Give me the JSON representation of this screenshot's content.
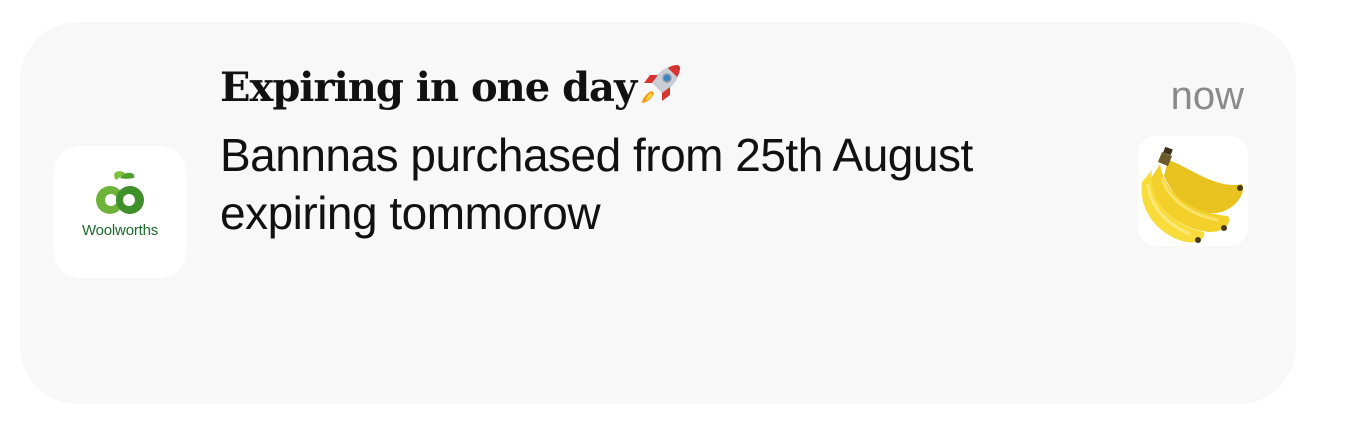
{
  "notification": {
    "app_name": "Woolworths",
    "title": "Expiring in one day",
    "title_emoji": "rocket-icon",
    "body": "Bannnas purchased from 25th August expiring tommorow",
    "time": "now",
    "thumbnail": "bananas-image"
  },
  "colors": {
    "card_background": "#f8f8f8",
    "brand_green": "#1d6b2c",
    "timestamp": "#8a8a8a"
  }
}
